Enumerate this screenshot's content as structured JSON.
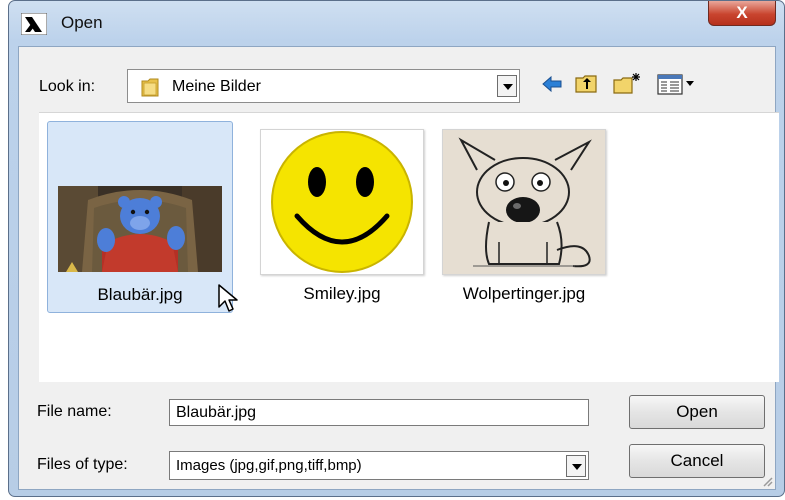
{
  "window": {
    "title": "Open",
    "close_label": "X"
  },
  "toolbar": {
    "look_in_label": "Look in:",
    "look_in_value": "Meine Bilder",
    "buttons": [
      "back-arrow-icon",
      "up-folder-icon",
      "new-folder-icon",
      "view-menu-icon"
    ]
  },
  "files": [
    {
      "name": "Blaubär.jpg",
      "selected": true,
      "thumbnail": "blue bear puppet on throne"
    },
    {
      "name": "Smiley.jpg",
      "selected": false,
      "thumbnail": "yellow smiley face"
    },
    {
      "name": "Wolpertinger.jpg",
      "selected": false,
      "thumbnail": "cartoon dog sketch"
    }
  ],
  "form": {
    "file_name_label": "File name:",
    "file_name_value": "Blaubär.jpg",
    "file_type_label": "Files of type:",
    "file_type_value": "Images (jpg,gif,png,tiff,bmp)"
  },
  "buttons": {
    "open": "Open",
    "cancel": "Cancel"
  },
  "colors": {
    "title_bar": "#bcd2eb",
    "close_button": "#c9452f",
    "selection": "#d8e7f8",
    "smiley_yellow": "#f5e400"
  }
}
